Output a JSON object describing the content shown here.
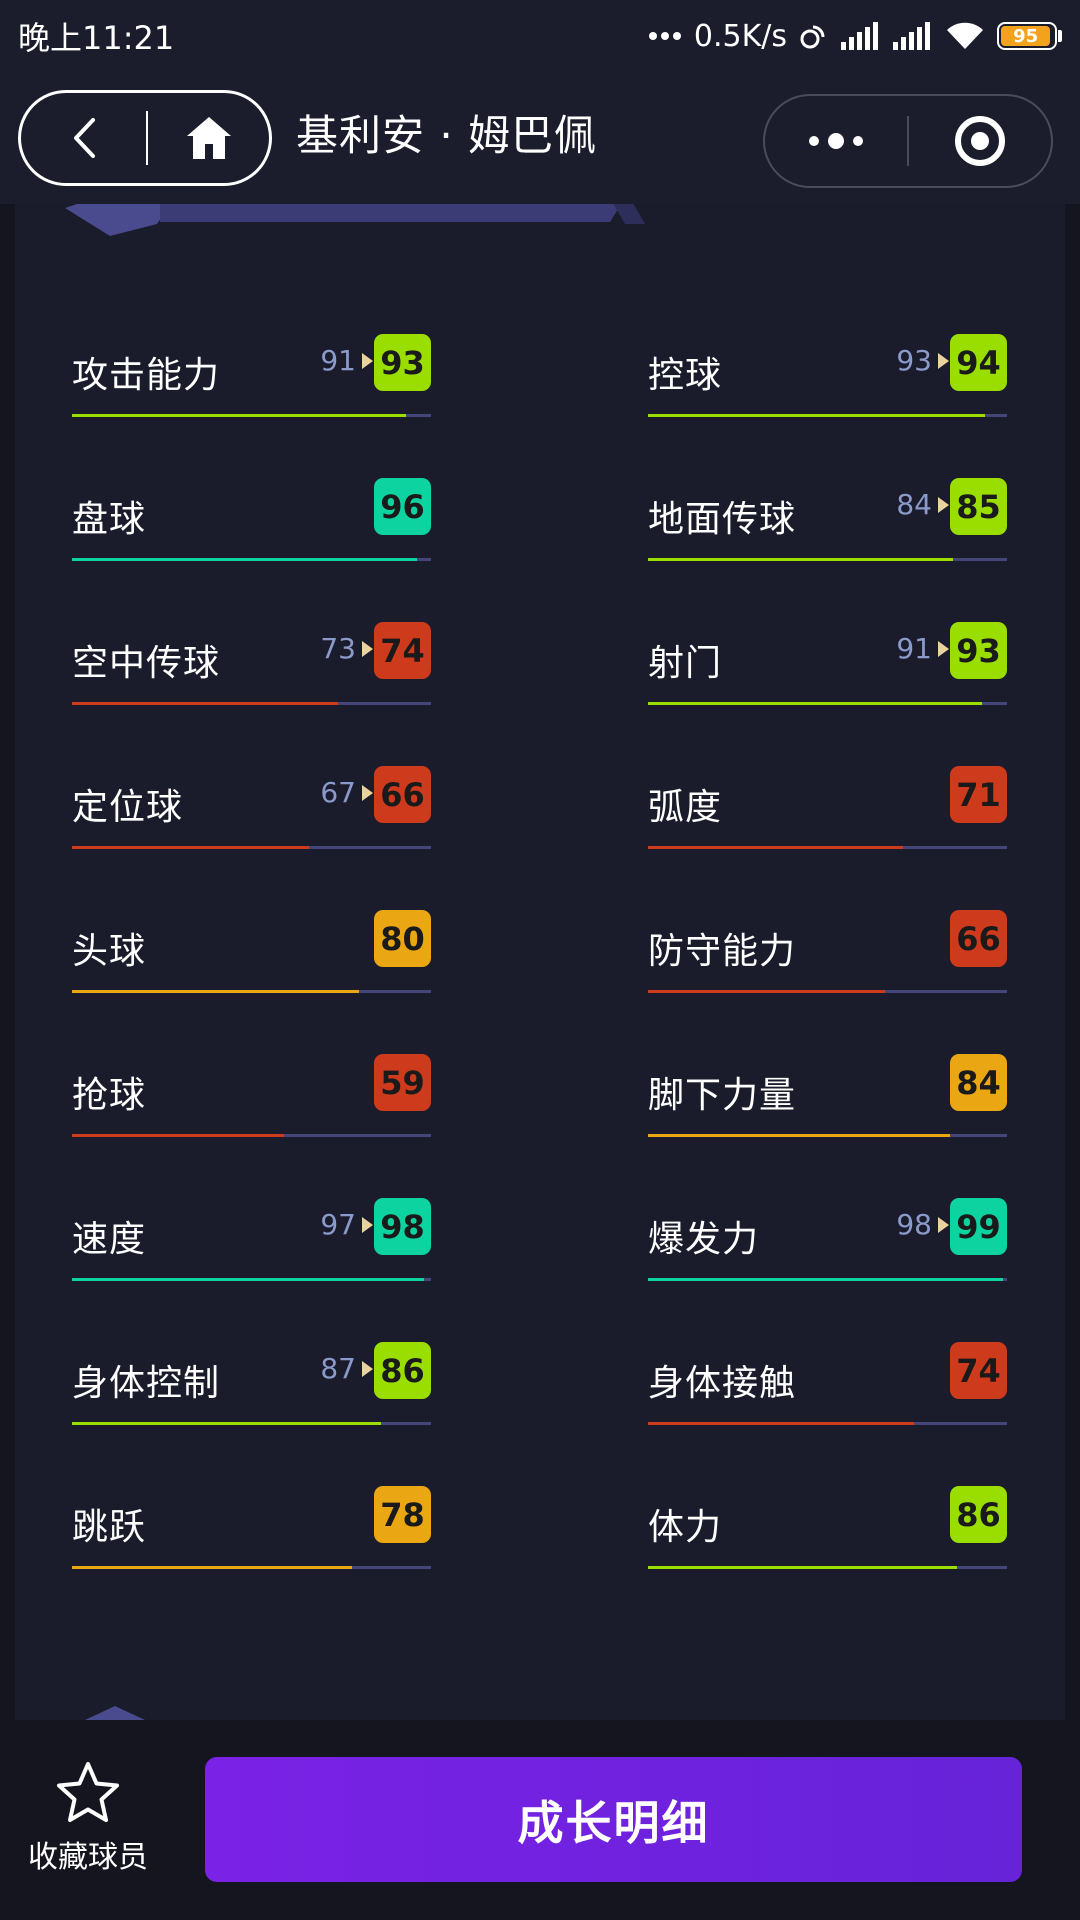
{
  "status_bar": {
    "time": "晚上11:21",
    "net_speed": "0.5K/s",
    "battery": "95",
    "battery_level": 0.95,
    "battery_color": "#f2a31b"
  },
  "nav": {
    "title": "基利安 · 姆巴佩",
    "back_icon": "chevron-left-icon",
    "home_icon": "home-icon",
    "more_icon": "more-dots-icon",
    "target_icon": "target-icon"
  },
  "colors": {
    "green": "#9ade00",
    "teal": "#0dd3a1",
    "orange": "#eba613",
    "red": "#cd3a1c",
    "track": "#45457a",
    "prev_text": "#8a9acb",
    "prev_arrow": "#e9d49a",
    "button": "#7a22e6"
  },
  "stats": [
    {
      "label": "攻击能力",
      "prev": "91",
      "value": "93",
      "level": 0.93,
      "color": "#9ade00"
    },
    {
      "label": "控球",
      "prev": "93",
      "value": "94",
      "level": 0.94,
      "color": "#9ade00"
    },
    {
      "label": "盘球",
      "prev": "",
      "value": "96",
      "level": 0.96,
      "color": "#0dd3a1"
    },
    {
      "label": "地面传球",
      "prev": "84",
      "value": "85",
      "level": 0.85,
      "color": "#9ade00"
    },
    {
      "label": "空中传球",
      "prev": "73",
      "value": "74",
      "level": 0.74,
      "color": "#cd3a1c"
    },
    {
      "label": "射门",
      "prev": "91",
      "value": "93",
      "level": 0.93,
      "color": "#9ade00"
    },
    {
      "label": "定位球",
      "prev": "67",
      "value": "66",
      "level": 0.66,
      "color": "#cd3a1c"
    },
    {
      "label": "弧度",
      "prev": "",
      "value": "71",
      "level": 0.71,
      "color": "#cd3a1c"
    },
    {
      "label": "头球",
      "prev": "",
      "value": "80",
      "level": 0.8,
      "color": "#eba613"
    },
    {
      "label": "防守能力",
      "prev": "",
      "value": "66",
      "level": 0.66,
      "color": "#cd3a1c"
    },
    {
      "label": "抢球",
      "prev": "",
      "value": "59",
      "level": 0.59,
      "color": "#cd3a1c"
    },
    {
      "label": "脚下力量",
      "prev": "",
      "value": "84",
      "level": 0.84,
      "color": "#eba613"
    },
    {
      "label": "速度",
      "prev": "97",
      "value": "98",
      "level": 0.98,
      "color": "#0dd3a1"
    },
    {
      "label": "爆发力",
      "prev": "98",
      "value": "99",
      "level": 0.99,
      "color": "#0dd3a1"
    },
    {
      "label": "身体控制",
      "prev": "87",
      "value": "86",
      "level": 0.86,
      "color": "#9ade00"
    },
    {
      "label": "身体接触",
      "prev": "",
      "value": "74",
      "level": 0.74,
      "color": "#cd3a1c"
    },
    {
      "label": "跳跃",
      "prev": "",
      "value": "78",
      "level": 0.78,
      "color": "#eba613"
    },
    {
      "label": "体力",
      "prev": "",
      "value": "86",
      "level": 0.86,
      "color": "#9ade00"
    }
  ],
  "bottom": {
    "favorite_label": "收藏球员",
    "favorite_icon": "star-icon",
    "growth_label": "成长明细"
  }
}
